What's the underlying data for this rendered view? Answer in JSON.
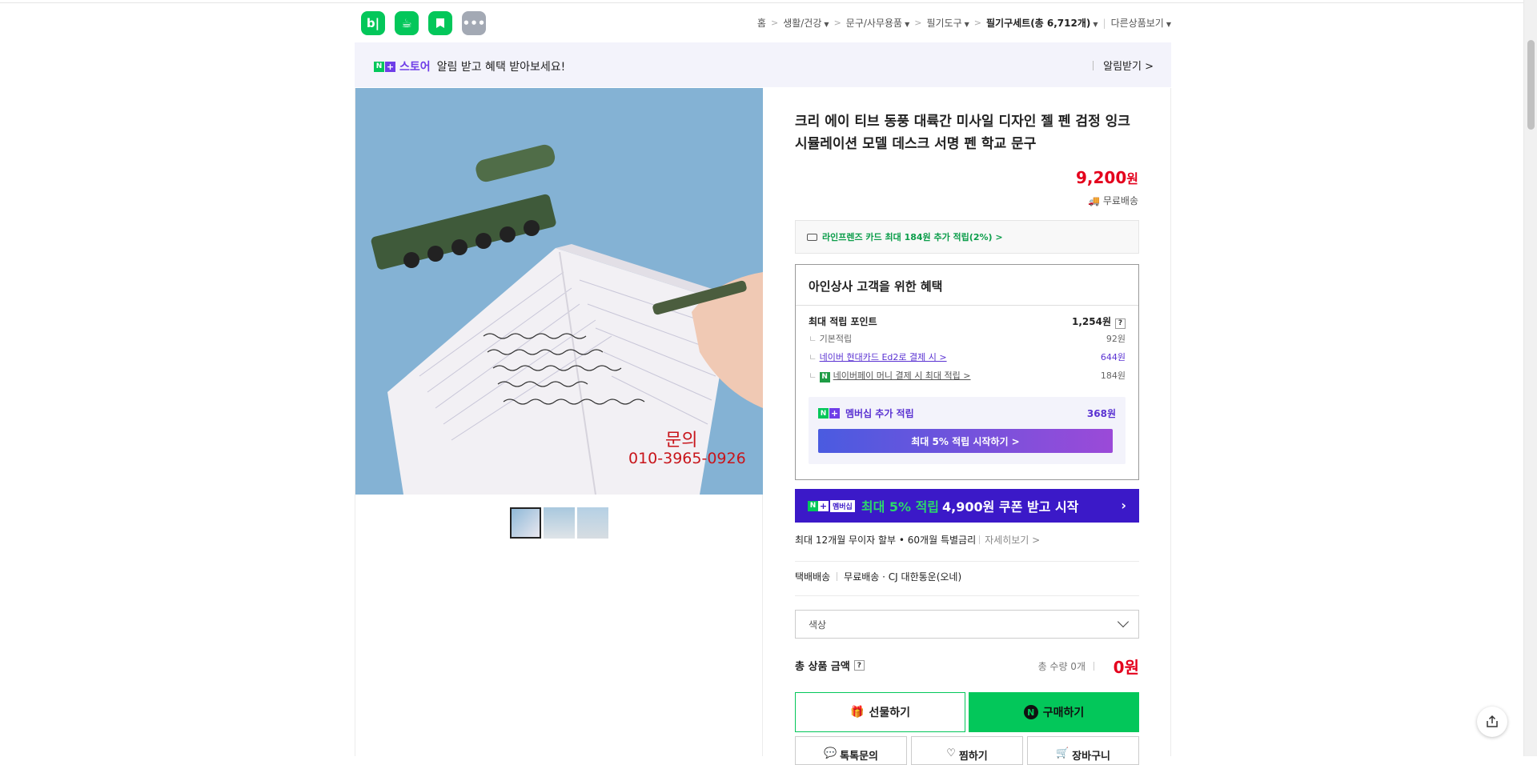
{
  "header": {
    "apps": [
      "b|",
      "☕",
      "✚",
      "•••"
    ],
    "breadcrumb": [
      {
        "label": "홈",
        "caret": false
      },
      {
        "label": "생활/건강",
        "caret": true
      },
      {
        "label": "문구/사무용품",
        "caret": true
      },
      {
        "label": "필기도구",
        "caret": true
      },
      {
        "label": "필기구세트(총 6,712개)",
        "caret": true,
        "current": true
      }
    ],
    "other_products": "다른상품보기"
  },
  "notice": {
    "store": "스토어",
    "text": "알림 받고 혜택 받아보세요!",
    "action": "알림받기 >"
  },
  "gallery": {
    "overlay_title": "문의",
    "overlay_phone": "010-3965-0926",
    "thumbnail_count": 3
  },
  "product": {
    "title": "크리 에이 티브 동풍 대륙간 미사일 디자인 젤 펜 검정 잉크 시뮬레이션 모델 데스크 서명 펜 학교 문구",
    "price": "9,200",
    "price_unit": "원",
    "shipping": "무료배송",
    "card_benefit": "라인프렌즈 카드 최대 184원 추가 적립(2%) >"
  },
  "benefit": {
    "heading": "아인상사 고객을 위한 혜택",
    "max_points_label": "최대 적립 포인트",
    "max_points_value": "1,254원",
    "rows": [
      {
        "label": "기본적립",
        "value": "92원"
      },
      {
        "label": "네이버 현대카드 Ed2로 결제 시 >",
        "value": "644원"
      },
      {
        "label": "네이버페이 머니 결제 시 최대 적립 >",
        "value": "184원"
      }
    ],
    "membership_label": "멤버십 추가 적립",
    "membership_value": "368원",
    "membership_button": "최대 5% 적립 시작하기 >"
  },
  "banner": {
    "tag": "멤버십",
    "accent": "최대 5% 적립",
    "text": "4,900원 쿠폰 받고 시작",
    "arrow": "›"
  },
  "installment": {
    "text": "최대 12개월 무이자 할부 • 60개월 특별금리",
    "more": "자세히보기 >"
  },
  "delivery": {
    "type": "택배배송",
    "fee": "무료배송",
    "courier": "CJ 대한통운(오네)"
  },
  "option_select": {
    "placeholder": "색상"
  },
  "total": {
    "label": "총 상품 금액",
    "quantity": "총 수량 0개",
    "price": "0원"
  },
  "actions": {
    "gift": "선물하기",
    "buy": "구매하기",
    "talk": "톡톡문의",
    "wish": "찜하기",
    "cart": "장바구니"
  },
  "colors": {
    "naver_green": "#03c75a",
    "price_red": "#e4001c",
    "purple": "#6f3ee8",
    "banner_blue": "#3b19c8"
  }
}
